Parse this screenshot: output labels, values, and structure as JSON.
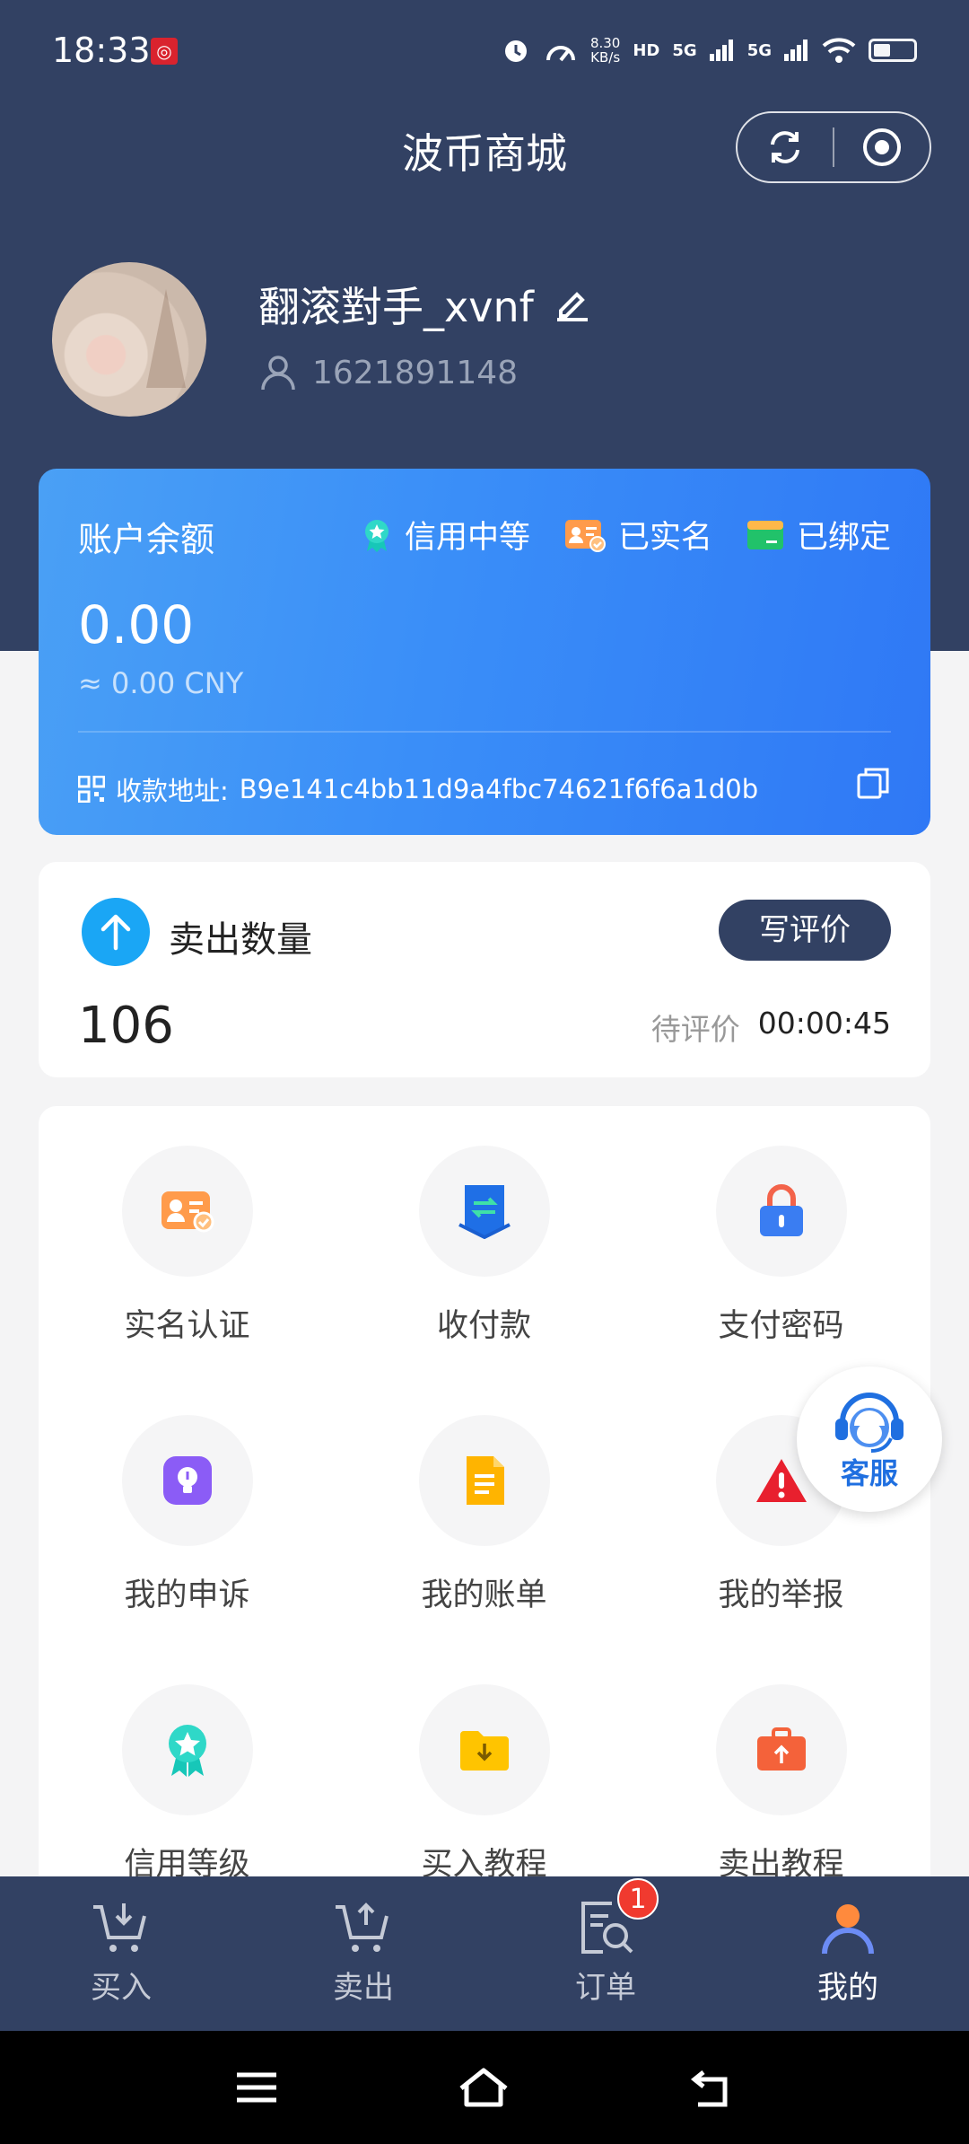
{
  "status_bar": {
    "time": "18:33",
    "net_speed_value": "8.30",
    "net_speed_unit": "KB/s",
    "hd_label": "HD",
    "signal1": "5G",
    "signal2": "5G"
  },
  "header": {
    "title": "波币商城"
  },
  "profile": {
    "username": "翻滚對手_xvnf",
    "uid": "1621891148"
  },
  "balance": {
    "label": "账户余额",
    "badges": [
      "信用中等",
      "已实名",
      "已绑定"
    ],
    "amount": "0.00",
    "cny": "≈ 0.00 CNY",
    "address_label": "收款地址:",
    "address": "B9e141c4bb11d9a4fbc74621f6f6a1d0b"
  },
  "sell": {
    "title": "卖出数量",
    "review_button": "写评价",
    "count": "106",
    "pending_label": "待评价",
    "pending_time": "00:00:45"
  },
  "menu": {
    "items": [
      {
        "label": "实名认证",
        "icon": "id-card-icon"
      },
      {
        "label": "收付款",
        "icon": "transfer-icon"
      },
      {
        "label": "支付密码",
        "icon": "lock-icon"
      },
      {
        "label": "我的申诉",
        "icon": "lightbulb-icon"
      },
      {
        "label": "我的账单",
        "icon": "document-icon"
      },
      {
        "label": "我的举报",
        "icon": "warning-icon"
      },
      {
        "label": "信用等级",
        "icon": "medal-icon"
      },
      {
        "label": "买入教程",
        "icon": "download-folder-icon"
      },
      {
        "label": "卖出教程",
        "icon": "upload-briefcase-icon"
      }
    ]
  },
  "customer_service": {
    "label": "客服"
  },
  "tabbar": {
    "tabs": [
      {
        "label": "买入"
      },
      {
        "label": "卖出"
      },
      {
        "label": "订单",
        "badge": "1"
      },
      {
        "label": "我的"
      }
    ],
    "active": "我的"
  },
  "colors": {
    "header_bg": "#324163",
    "card_gradient_start": "#4aa0f5",
    "card_gradient_end": "#2f78f5",
    "accent_blue": "#1aa6f5",
    "badge_red": "#f03a2f"
  }
}
